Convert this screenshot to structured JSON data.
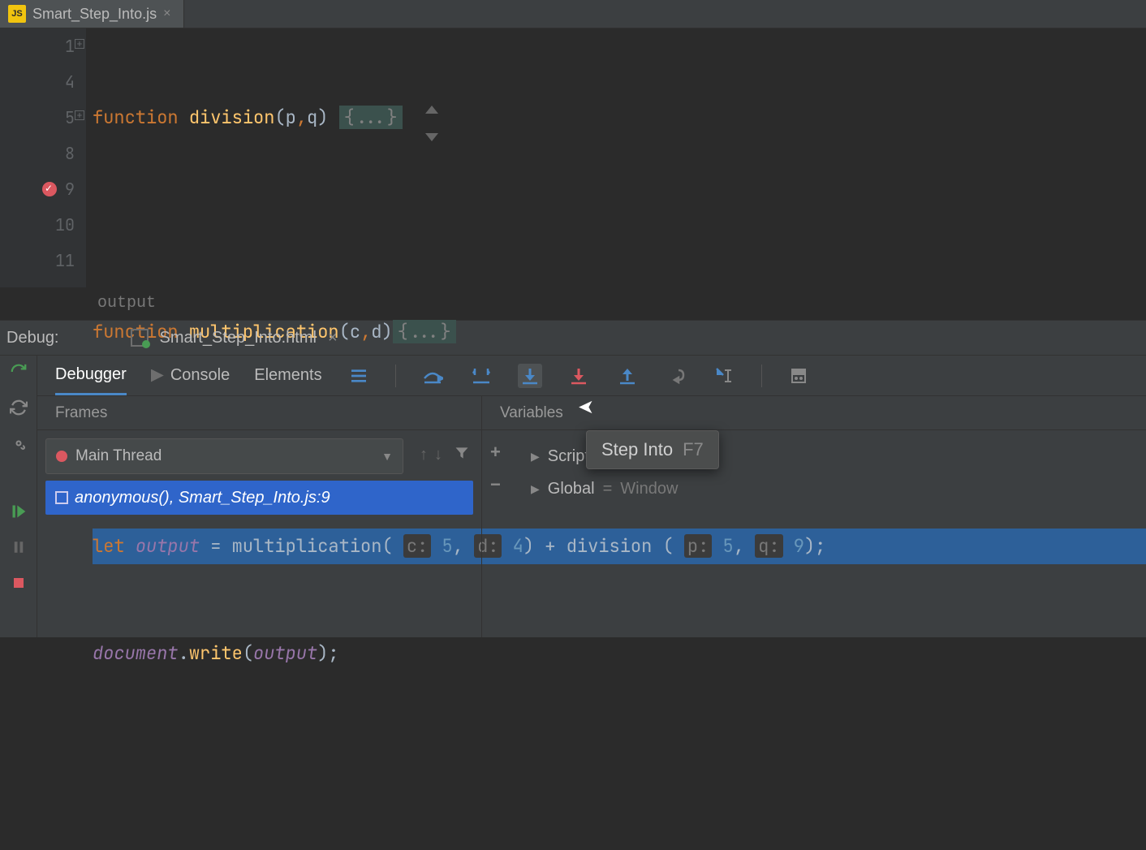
{
  "tab": {
    "filename": "Smart_Step_Into.js",
    "icon_label": "JS"
  },
  "editor": {
    "line_numbers": [
      "1",
      "4",
      "5",
      "8",
      "9",
      "10",
      "11"
    ],
    "lines": [
      {
        "type": "fn_def",
        "kw": "function",
        "name": "division",
        "params": "(",
        "p1": "p",
        "comma": ",",
        "p2": "q",
        "close": ") ",
        "fold": "{...}"
      },
      {
        "type": "blank"
      },
      {
        "type": "fn_def",
        "kw": "function",
        "name": "multiplication",
        "params": "(",
        "p1": "c",
        "comma": ",",
        "p2": "d",
        "close": ")",
        "fold": "{...}"
      },
      {
        "type": "blank"
      },
      {
        "type": "exec",
        "text_pre": "let ",
        "var": "output",
        "eq": " = ",
        "call1": "multiplication",
        "open1": "( ",
        "h1": "c:",
        "n1": "5",
        "h1b": ", ",
        "h2": "d:",
        "n2": "4",
        "close1": ") + ",
        "call2": "division",
        "open2": " ( ",
        "h3": "p:",
        "n3": "5",
        "h3b": ", ",
        "h4": "q:",
        "n4": "9",
        "close2": ");"
      },
      {
        "type": "doc",
        "obj": "document",
        "dot": ".",
        "method": "write",
        "open": "(",
        "arg": "output",
        "close": ");"
      },
      {
        "type": "blank"
      }
    ],
    "inlay": "output"
  },
  "debug": {
    "label": "Debug:",
    "session": "Smart_Step_Into.html",
    "tabs": {
      "debugger": "Debugger",
      "console": "Console",
      "elements": "Elements"
    },
    "frames_title": "Frames",
    "variables_title": "Variables",
    "thread": "Main Thread",
    "frame": "anonymous(), Smart_Step_Into.js:9",
    "vars": [
      {
        "name": "Script",
        "value": ""
      },
      {
        "name": "Global",
        "eq": " = ",
        "value": "Window"
      }
    ]
  },
  "tooltip": {
    "text": "Step Into",
    "shortcut": "F7"
  }
}
